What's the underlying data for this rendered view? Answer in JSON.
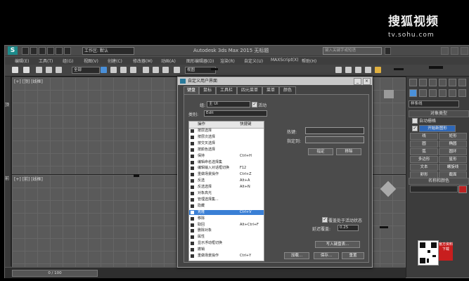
{
  "watermark": {
    "brand": "搜狐视频",
    "url": "tv.sohu.com"
  },
  "app": {
    "logo_text": "S",
    "workspace": "工作区: 默认",
    "title": "Autodesk 3ds Max  2015    无标题",
    "search_placeholder": "键入关键字或短语",
    "menus": [
      "编辑(E)",
      "工具(T)",
      "组(G)",
      "视图(V)",
      "创建(C)",
      "修改器(M)",
      "动画(A)",
      "图形编辑器(D)",
      "渲染(R)",
      "自定义(U)",
      "MAXScript(X)",
      "帮助(H)"
    ],
    "selection_filter": "全部",
    "view_select": "视图"
  },
  "viewports": {
    "top_left": "[+] [顶] [线框]",
    "top_right": "",
    "bottom_left": "[+] [前] [线框]",
    "bottom_right": ""
  },
  "left_strip": {
    "labels": [
      "顶",
      "前"
    ]
  },
  "command_panel": {
    "category": "样条线",
    "object_type_header": "对象类型",
    "auto_grid": "自动栅格",
    "start_new_shape": "开始新图形",
    "object_buttons": [
      "线",
      "矩形",
      "圆",
      "椭圆",
      "弧",
      "圆环",
      "多边形",
      "星形",
      "文本",
      "螺旋线",
      "卵形",
      "截面"
    ],
    "name_color_header": "名称和颜色",
    "promo_text": "官方资料下载"
  },
  "status": {
    "time_slider": "0 / 100"
  },
  "dialog": {
    "title": "自定义用户界面",
    "tabs": [
      "键盘",
      "鼠标",
      "工具栏",
      "四元菜单",
      "菜单",
      "颜色"
    ],
    "group_label": "组:",
    "group_value": "主 UI",
    "active_label": "活动",
    "category_label": "类别:",
    "category_value": "Edit",
    "list_headers": {
      "action": "操作",
      "shortcut": "快捷键"
    },
    "actions": [
      {
        "name": "按层选择",
        "key": ""
      },
      {
        "name": "按层次选择",
        "key": ""
      },
      {
        "name": "按交叉选择",
        "key": ""
      },
      {
        "name": "按颜色选择",
        "key": ""
      },
      {
        "name": "保持",
        "key": "Ctrl+H"
      },
      {
        "name": "编辑命名选择集",
        "key": ""
      },
      {
        "name": "编辑输入对话框切换",
        "key": "F12"
      },
      {
        "name": "重做场景操作",
        "key": "Ctrl+Z"
      },
      {
        "name": "反选",
        "key": "Alt+A"
      },
      {
        "name": "反选选择",
        "key": "Alt+N"
      },
      {
        "name": "对象高光",
        "key": ""
      },
      {
        "name": "管理选择集...",
        "key": ""
      },
      {
        "name": "隐藏",
        "key": ""
      },
      {
        "name": "克隆",
        "key": "Ctrl+V"
      },
      {
        "name": "移除",
        "key": ""
      },
      {
        "name": "取回",
        "key": "Alt+Ctrl+F"
      },
      {
        "name": "删除对象",
        "key": ""
      },
      {
        "name": "属性",
        "key": ""
      },
      {
        "name": "显示浮动框切换",
        "key": ""
      },
      {
        "name": "撤销",
        "key": ""
      },
      {
        "name": "重做场景操作",
        "key": "Ctrl+Y"
      }
    ],
    "selected_index": 13,
    "hotkey_label": "热键:",
    "assigned_to_label": "指定到:",
    "assign_button": "指定",
    "remove_button": "移除",
    "override_label": "覆盖处于活动状态",
    "delay_label": "延迟覆盖:",
    "delay_value": "0.25",
    "write_keyboard_button": "写入键盘表...",
    "load_button": "加载...",
    "save_button": "保存...",
    "reset_button": "重置"
  }
}
